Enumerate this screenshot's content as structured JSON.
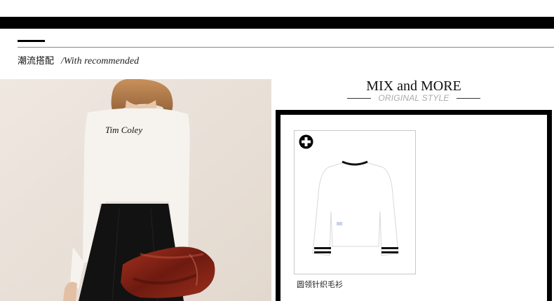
{
  "section": {
    "title": "潮流搭配",
    "subtitle": "/With recommended"
  },
  "photo": {
    "print_text": "Tim Coley"
  },
  "mix": {
    "title": "MIX and MORE",
    "subtitle": "ORIGINAL STYLE"
  },
  "product": {
    "name": "圆领针织毛衫"
  },
  "icons": {
    "add": "plus-circle-icon"
  },
  "colors": {
    "black": "#000000",
    "rule": "#888888",
    "subtitle_gray": "#aaaaaa",
    "card_border": "#c8c8c8"
  }
}
